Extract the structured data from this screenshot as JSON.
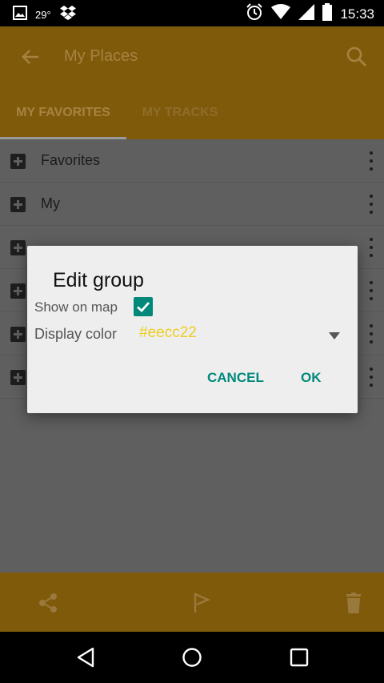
{
  "status_bar": {
    "temperature": "29°",
    "time": "15:33",
    "icons": [
      "image-icon",
      "dropbox-icon",
      "alarm-icon",
      "wifi-icon",
      "signal-icon",
      "battery-icon"
    ]
  },
  "app_bar": {
    "title": "My Places",
    "icons": [
      "back-arrow-icon",
      "search-icon"
    ]
  },
  "tabs": [
    {
      "label": "MY FAVORITES",
      "active": true
    },
    {
      "label": "MY TRACKS",
      "active": false
    }
  ],
  "list": {
    "items": [
      {
        "label": "Favorites"
      },
      {
        "label": "My"
      }
    ]
  },
  "dialog": {
    "title": "Edit group",
    "show_on_map_label": "Show on map",
    "show_on_map_checked": true,
    "display_color_label": "Display color",
    "display_color_value": "#eecc22",
    "cancel_label": "CANCEL",
    "ok_label": "OK"
  },
  "bottom_bar": {
    "icons": [
      "share-icon",
      "flag-icon",
      "trash-icon"
    ]
  },
  "colors": {
    "accent": "#00897b",
    "appbar_dimmed": "#7e5a0a",
    "display_color": "#eecc22"
  }
}
